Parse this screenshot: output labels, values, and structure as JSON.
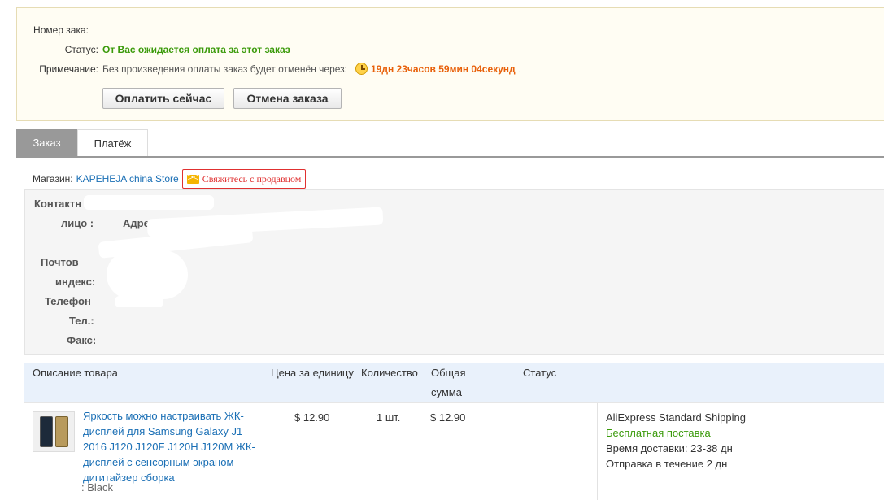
{
  "order": {
    "number_label": "Номер зака:",
    "status_label": "Статус:",
    "status_value": "От Вас ожидается оплата за этот заказ",
    "note_label": "Примечание:",
    "note_text": "Без произведения оплаты заказ будет отменён через:",
    "countdown": "19дн 23часов 59мин 04секунд",
    "countdown_suffix": ".",
    "pay_button": "Оплатить сейчас",
    "cancel_button": "Отмена заказа"
  },
  "tabs": [
    {
      "label": "Заказ",
      "active": true
    },
    {
      "label": "Платёж",
      "active": false
    }
  ],
  "store": {
    "label": "Магазин:",
    "name": "KAPEHEJA china Store",
    "contact_button": "Свяжитесь с продавцом"
  },
  "contact": {
    "person_label_1": "Контактн",
    "person_label_2": "лицо :",
    "address_label": "Адре",
    "postal_label_1": "Почтов",
    "postal_label_2": "индекс:",
    "phone_label": "Телефон",
    "tel_label": "Тел.:",
    "fax_label": "Факс:"
  },
  "table": {
    "headers": {
      "description": "Описание товара",
      "unit_price": "Цена за единицу",
      "quantity": "Количество",
      "total_1": "Общая",
      "total_2": "сумма",
      "status": "Статус"
    },
    "rows": [
      {
        "title": "Яркость можно настраивать ЖК-дисплей для Samsung Galaxy J1 2016 J120 J120F J120H J120M ЖК-дисплей с сенсорным экраном дигитайзер сборка",
        "variant": ": Black",
        "unit_price": "$ 12.90",
        "quantity": "1 шт.",
        "total": "$ 12.90",
        "shipping_method": "AliExpress Standard Shipping",
        "shipping_cost": "Бесплатная поставка",
        "delivery_time": "Время доставки: 23-38 дн",
        "dispatch": "Отправка в течение 2 дн"
      }
    ]
  },
  "colors": {
    "status_green": "#3a9a0a",
    "countdown_orange": "#e8600a",
    "link_blue": "#1a6fb5",
    "contact_red": "#e03030",
    "tab_active_bg": "#999999",
    "table_head_bg": "#e9f1fb"
  }
}
